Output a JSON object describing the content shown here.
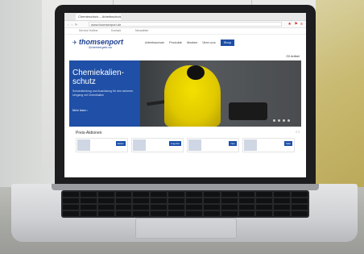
{
  "browser": {
    "tab_label": "Chemieschutz – Arbeitsschutz",
    "url": "www.thomsenport.de",
    "nav_dots": "‹ › ⟳",
    "tool_icons": "★ ⚑ ≡"
  },
  "site": {
    "top_links": [
      "Service Hotline",
      "Kontakt",
      "Newsletter"
    ],
    "logo": "thomsenport",
    "logo_mark": "✈",
    "logo_tagline": "Sicherheit geht vor",
    "nav": [
      "Arbeitsschutz",
      "Produkte",
      "Marken",
      "Über uns",
      "Shop"
    ],
    "search_icon": "⌕",
    "cart_label": "0 Artikel"
  },
  "hero": {
    "title": "Chemiekalien-schutz",
    "text": "Schutzkleidung und Ausrüstung für den sicheren Umgang mit Chemikalien",
    "link": "Mehr lesen ›"
  },
  "promos": {
    "title": "Preis-Aktionen",
    "arrows": "‹ ›",
    "cards": [
      "Aktion",
      "Angebot",
      "Neu",
      "Sale"
    ]
  },
  "colors": {
    "brand_blue": "#1b4fa8",
    "suit_yellow": "#f3e100"
  }
}
